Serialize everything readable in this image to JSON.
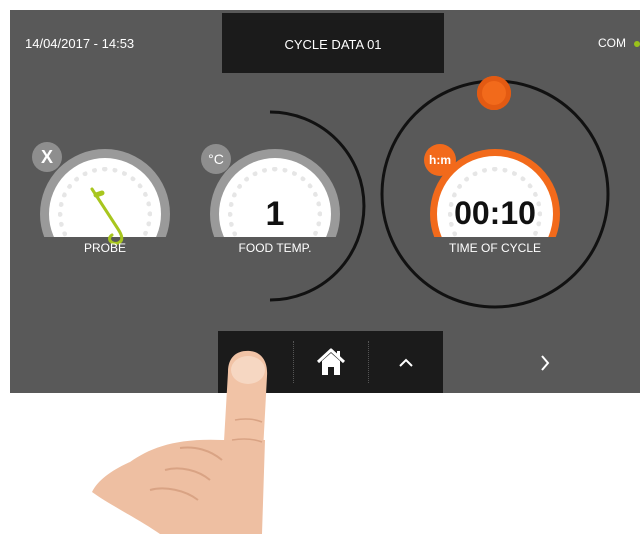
{
  "header": {
    "datetime": "14/04/2017 - 14:53",
    "title": "CYCLE DATA 01",
    "com_label": "COM"
  },
  "dials": {
    "probe": {
      "badge": "X",
      "label": "PROBE"
    },
    "food_temp": {
      "badge": "°C",
      "value": "1",
      "label": "FOOD TEMP."
    },
    "time_of_cycle": {
      "badge": "h:m",
      "value": "00:10",
      "label": "TIME OF CYCLE"
    }
  },
  "nav": {
    "icons": [
      "back-icon",
      "home-icon",
      "chevron-up-icon",
      "chevron-right-icon"
    ]
  },
  "colors": {
    "screen_bg": "#595959",
    "accent_orange": "#f26a1b",
    "probe_green": "#a8c61e",
    "com_led": "#9ac11a",
    "bar_bg": "#1b1b1b"
  }
}
